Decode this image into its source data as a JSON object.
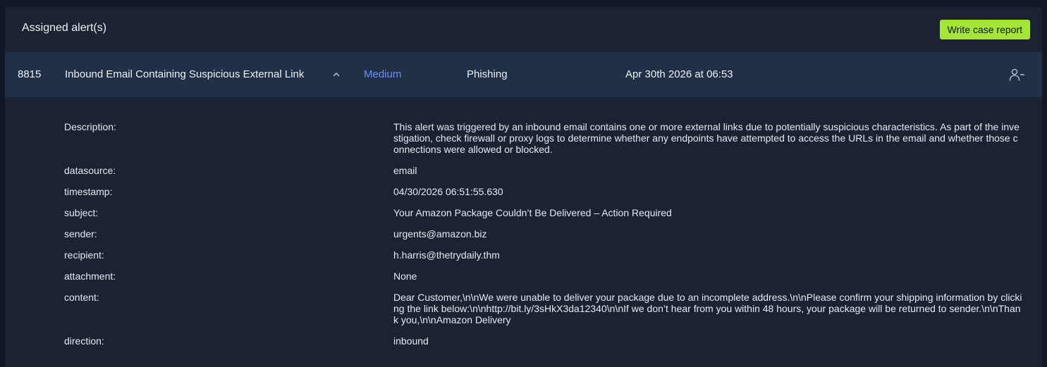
{
  "panel": {
    "title": "Assigned alert(s)",
    "write_report_label": "Write case report"
  },
  "alert": {
    "id": "8815",
    "title": "Inbound Email Containing Suspicious External Link",
    "severity": "Medium",
    "type": "Phishing",
    "date": "Apr 30th 2026 at 06:53",
    "icons": {
      "collapse": "chevron-up-icon",
      "unassign": "user-minus-icon"
    },
    "colors": {
      "severity": "#6f8ff8",
      "accent_button": "#a3e635"
    }
  },
  "details": [
    {
      "key": "Description:",
      "value": "This alert was triggered by an inbound email contains one or more external links due to potentially suspicious characteristics. As part of the investigation, check firewall or proxy logs to determine whether any endpoints have attempted to access the URLs in the email and whether those connections were allowed or blocked."
    },
    {
      "key": "datasource:",
      "value": "email"
    },
    {
      "key": "timestamp:",
      "value": "04/30/2026 06:51:55.630"
    },
    {
      "key": "subject:",
      "value": "Your Amazon Package Couldn’t Be Delivered – Action Required"
    },
    {
      "key": "sender:",
      "value": "urgents@amazon.biz"
    },
    {
      "key": "recipient:",
      "value": "h.harris@thetrydaily.thm"
    },
    {
      "key": "attachment:",
      "value": "None"
    },
    {
      "key": "content:",
      "value": "Dear Customer,\\n\\nWe were unable to deliver your package due to an incomplete address.\\n\\nPlease confirm your shipping information by clicking the link below:\\n\\nhttp://bit.ly/3sHkX3da12340\\n\\nIf we don’t hear from you within 48 hours, your package will be returned to sender.\\n\\nThank you,\\n\\nAmazon Delivery"
    },
    {
      "key": "direction:",
      "value": "inbound"
    }
  ]
}
